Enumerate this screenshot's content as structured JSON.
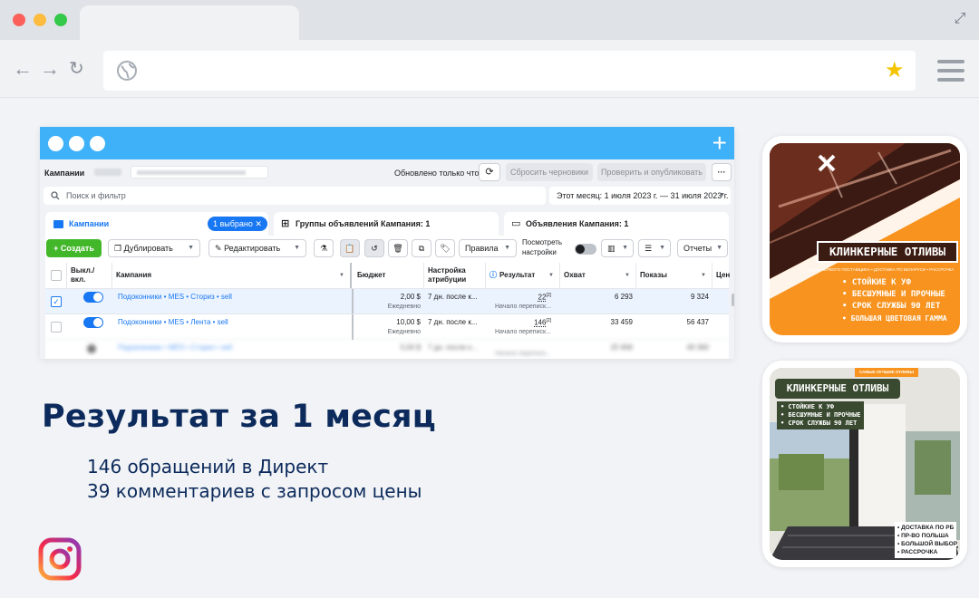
{
  "colors": {
    "dot_red": "#fc605b",
    "dot_yellow": "#fdbc40",
    "dot_green": "#34c84a",
    "window_header": "#3fb1f8",
    "fb_blue": "#1877f2",
    "create_green": "#42b72a",
    "headline": "#0c2a5b",
    "orange": "#f7931e"
  },
  "ads_manager": {
    "campaigns_title": "Кампании",
    "updated_text": "Обновлено только что",
    "reset_drafts": "Сбросить черновики",
    "review_publish": "Проверить и опубликовать",
    "more": "···",
    "search_placeholder": "Поиск и фильтр",
    "date_range": "Этот месяц: 1 июля 2023 г. — 31 июля 2023 г.",
    "tabs": {
      "campaigns": "Кампании",
      "selected_badge": "1 выбрано",
      "ad_sets": "Группы объявлений Кампания: 1",
      "ads": "Объявления Кампания: 1"
    },
    "toolbar": {
      "create": "+ Создать",
      "duplicate": "Дублировать",
      "edit": "Редактировать",
      "rules": "Правила",
      "view_settings_1": "Посмотреть",
      "view_settings_2": "настройки",
      "reports": "Отчеты"
    },
    "columns": {
      "onoff_1": "Выкл./",
      "onoff_2": "вкл.",
      "campaign": "Кампания",
      "budget": "Бюджет",
      "attribution_1": "Настройка",
      "attribution_2": "атрибуции",
      "result": "Результат",
      "reach": "Охват",
      "impressions": "Показы",
      "cost": "Цен"
    },
    "rows": [
      {
        "name": "Подоконники • MES • Сториз • sell",
        "budget": "2,00 $",
        "budget_sub": "Ежедневно",
        "attribution": "7 дн. после к...",
        "result": "22",
        "result_sup": "[2]",
        "result_sub": "Начало переписк...",
        "reach": "6 293",
        "impressions": "9 324"
      },
      {
        "name": "Подоконники • MES • Лента • sell",
        "budget": "10,00 $",
        "budget_sub": "Ежедневно",
        "attribution": "7 дн. после к...",
        "result": "146",
        "result_sup": "[2]",
        "result_sub": "Начало переписк...",
        "reach": "33 459",
        "impressions": "56 437"
      }
    ],
    "blurred_row": {
      "name": "Подоконники • MES • Сториз • sell",
      "budget": "5,00 $",
      "attribution": "7 дн. после к...",
      "result_sub": "Начало переписк...",
      "reach": "25 906",
      "impressions": "49 360"
    }
  },
  "headline": "Результат за 1 месяц",
  "stats": [
    "146 обращений в Директ",
    "39 комментариев  с запросом цены"
  ],
  "ad1": {
    "title": "КЛИНКЕРНЫЕ ОТЛИВЫ",
    "subtitle": "ЦЕНЫ ПЕРВОГО ПОСТАВЩИКА • ДОСТАВКА ПО БЕЛАРУСИ • РАССРОЧКА",
    "bullets": [
      "• СТОЙКИЕ К УФ",
      "• БЕСШУМНЫЕ И ПРОЧНЫЕ",
      "• СРОК СЛУЖБЫ 90 ЛЕТ",
      "• БОЛЬШАЯ ЦВЕТОВАЯ ГАММА"
    ]
  },
  "ad2": {
    "tag": "САМЫЕ ЛУЧШИЕ ОТЛИВЫ",
    "title": "КЛИНКЕРНЫЕ ОТЛИВЫ",
    "bullets": [
      "• СТОЙКИЕ К УФ",
      "• БЕСШУМНЫЕ И ПРОЧНЫЕ",
      "• СРОК СЛУЖБЫ 90 ЛЕТ"
    ],
    "bottom_bullets": [
      "• ДОСТАВКА ПО РБ",
      "• ПР-ВО ПОЛЬША",
      "• БОЛЬШОЙ ВЫБОР",
      "• РАССРОЧКА"
    ]
  }
}
